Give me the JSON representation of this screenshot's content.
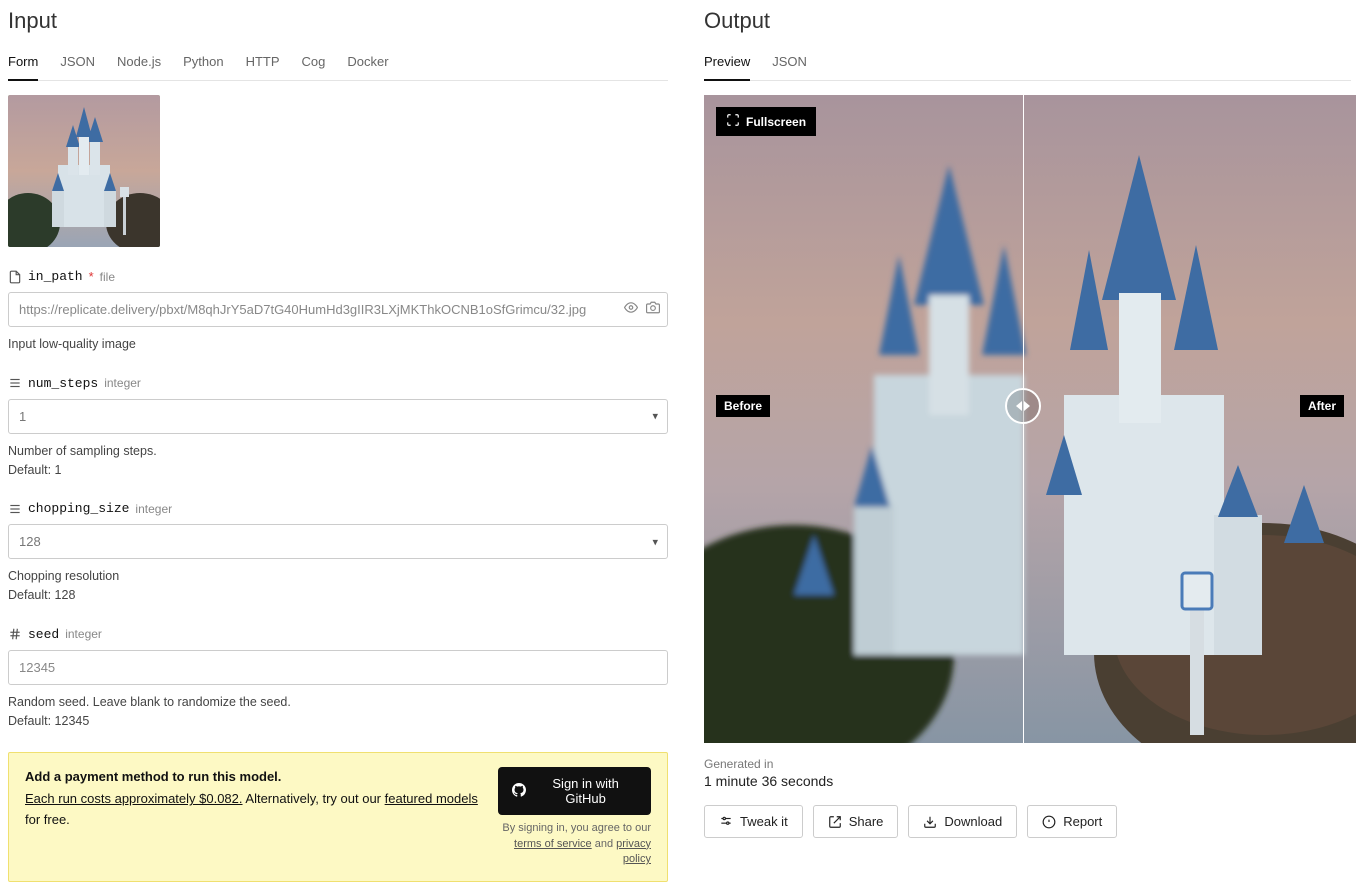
{
  "input": {
    "title": "Input",
    "tabs": [
      "Form",
      "JSON",
      "Node.js",
      "Python",
      "HTTP",
      "Cog",
      "Docker"
    ],
    "active_tab": "Form",
    "fields": {
      "in_path": {
        "icon": "file-icon",
        "name": "in_path",
        "required_mark": "*",
        "type": "file",
        "value": "https://replicate.delivery/pbxt/M8qhJrY5aD7tG40HumHd3gIIR3LXjMKThkOCNB1oSfGrimcu/32.jpg",
        "helper": "Input low-quality image"
      },
      "num_steps": {
        "icon": "sliders-icon",
        "name": "num_steps",
        "type": "integer",
        "value": "1",
        "helper": "Number of sampling steps.",
        "default_label": "Default: 1"
      },
      "chopping_size": {
        "icon": "sliders-icon",
        "name": "chopping_size",
        "type": "integer",
        "value": "128",
        "helper": "Chopping resolution",
        "default_label": "Default: 128"
      },
      "seed": {
        "icon": "hash-icon",
        "name": "seed",
        "type": "integer",
        "value": "12345",
        "helper": "Random seed. Leave blank to randomize the seed.",
        "default_label": "Default: 12345"
      }
    },
    "banner": {
      "title": "Add a payment method to run this model.",
      "cost_link": "Each run costs approximately $0.082.",
      "alt_text": " Alternatively, try out our ",
      "featured_link": "featured models",
      "for_free": " for free.",
      "signin_label": "Sign in with GitHub",
      "legal_prefix": "By signing in, you agree to our ",
      "terms": "terms of service",
      "and": " and ",
      "privacy": "privacy policy"
    }
  },
  "output": {
    "title": "Output",
    "tabs": [
      "Preview",
      "JSON"
    ],
    "active_tab": "Preview",
    "fullscreen": "Fullscreen",
    "before": "Before",
    "after": "After",
    "generated_label": "Generated in",
    "generated_time": "1 minute 36 seconds",
    "actions": {
      "tweak": "Tweak it",
      "share": "Share",
      "download": "Download",
      "report": "Report"
    }
  }
}
